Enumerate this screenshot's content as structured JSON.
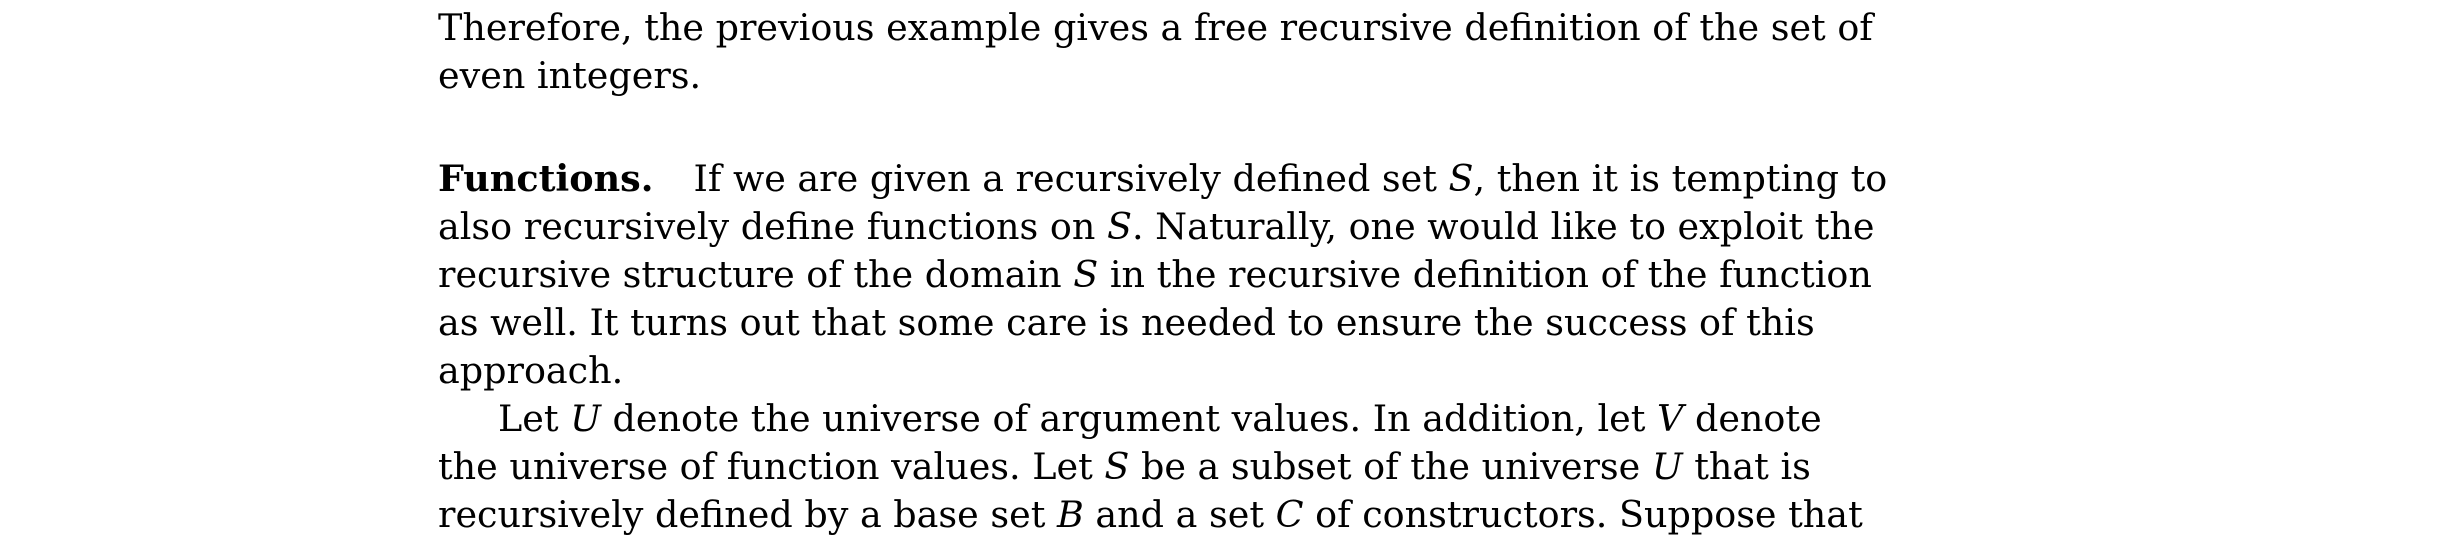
{
  "paragraph_prev": {
    "lines": [
      "Therefore, the previous example gives a free recursive definition of the set of",
      "even integers."
    ]
  },
  "functions": {
    "heading": "Functions.",
    "line1": [
      "If we are given a recursively defined set ",
      "S",
      ", then it is tempting to"
    ],
    "line2": [
      "also recursively define functions on ",
      "S",
      ". Naturally, one would like to exploit the"
    ],
    "line3": [
      "recursive structure of the domain ",
      "S",
      " in the recursive definition of the function"
    ],
    "line4": "as well. It turns out that some care is needed to ensure the success of this",
    "line5": "approach."
  },
  "paragraph_next": {
    "line1": [
      "Let ",
      "U",
      " denote the universe of argument values. In addition, let ",
      "V",
      " denote"
    ],
    "line2": [
      "the universe of function values. Let ",
      "S",
      " be a subset of the universe ",
      "U",
      " that is"
    ],
    "line3": [
      "recursively defined by a base set ",
      "B",
      " and a set ",
      "C",
      " of constructors. Suppose that"
    ]
  }
}
